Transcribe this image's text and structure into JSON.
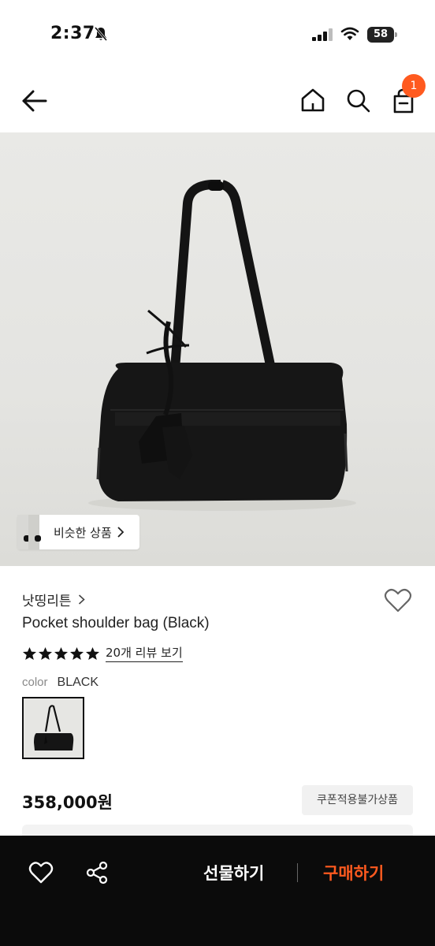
{
  "status_bar": {
    "time": "2:37",
    "battery": "58"
  },
  "header": {
    "cart_count": "1"
  },
  "similar": {
    "label": "비슷한 상품"
  },
  "product": {
    "brand": "낫띵리튼",
    "name": "Pocket shoulder bag (Black)",
    "rating_stars": 5,
    "review_link": "20개 리뷰 보기",
    "color_label": "color",
    "color_value": "BLACK",
    "price": "358,000원",
    "coupon_badge": "쿠폰적용불가상품"
  },
  "bottom_bar": {
    "gift_label": "선물하기",
    "buy_label": "구매하기"
  },
  "colors": {
    "accent": "#ff5a1f",
    "bottom_bar_bg": "#0b0b0b"
  },
  "icons": {
    "header": [
      "back-arrow-icon",
      "home-icon",
      "search-icon",
      "cart-icon"
    ],
    "bottom": [
      "heart-icon",
      "share-icon"
    ]
  }
}
